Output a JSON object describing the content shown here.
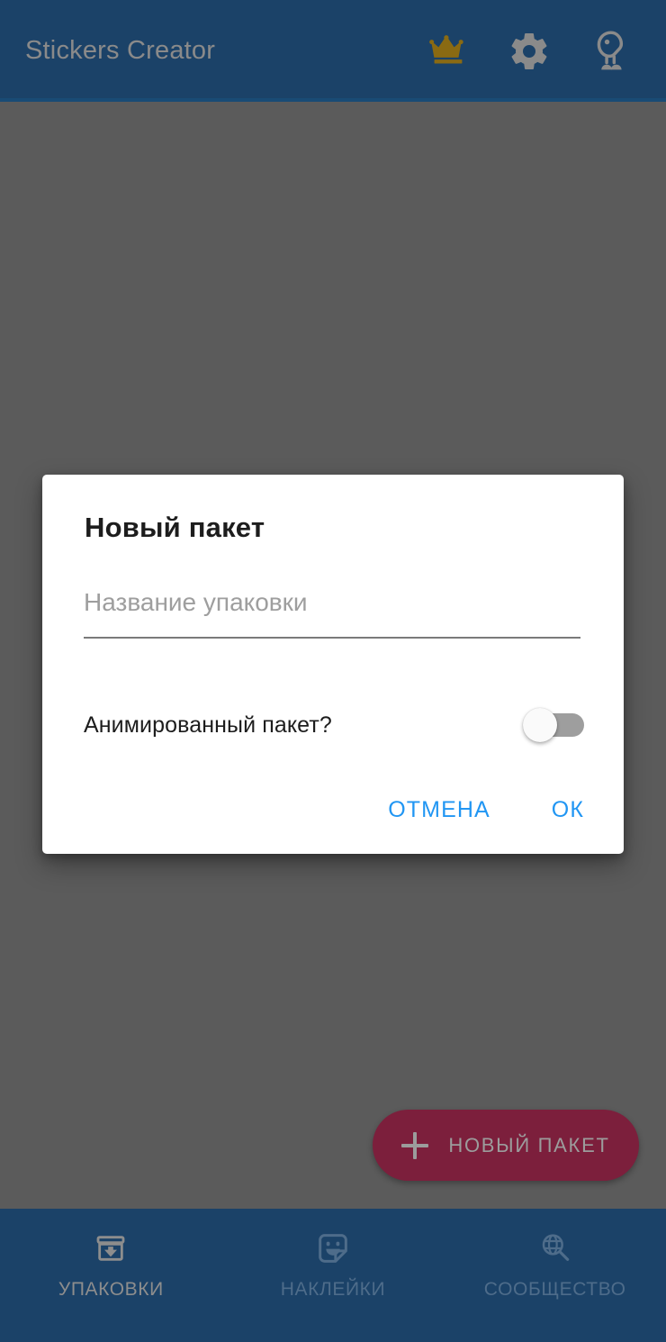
{
  "appbar": {
    "title": "Stickers Creator",
    "background": "#1b4268",
    "title_color": "#8a8a8a",
    "actions": [
      {
        "name": "crown-icon",
        "label": "Premium",
        "color": "#8a6a12"
      },
      {
        "name": "gear-icon",
        "label": "Settings",
        "color": "#8a8a8a"
      },
      {
        "name": "mascot-bird-icon",
        "label": "Mascot",
        "color": "#8a8a8a"
      }
    ]
  },
  "scrim": {
    "color": "#5b5b5b"
  },
  "fab": {
    "label": "НОВЫЙ ПАКЕТ",
    "icon": "plus-icon",
    "background": "#7c1f3c",
    "text_color": "#9c9c9c"
  },
  "bottom_nav": {
    "background": "#1b4268",
    "items": [
      {
        "label": "УПАКОВКИ",
        "icon": "archive-box-down-arrow-icon",
        "active": true
      },
      {
        "label": "НАКЛЕЙКИ",
        "icon": "sticker-smiley-icon",
        "active": false
      },
      {
        "label": "СООБЩЕСТВО",
        "icon": "globe-search-icon",
        "active": false
      }
    ]
  },
  "dialog": {
    "title": "Новый пакет",
    "name_field": {
      "placeholder": "Название упаковки",
      "value": ""
    },
    "animated_switch": {
      "label": "Анимированный пакет?",
      "checked": false
    },
    "cancel_label": "ОТМЕНА",
    "ok_label": "ОК",
    "action_color": "#2196f3"
  }
}
